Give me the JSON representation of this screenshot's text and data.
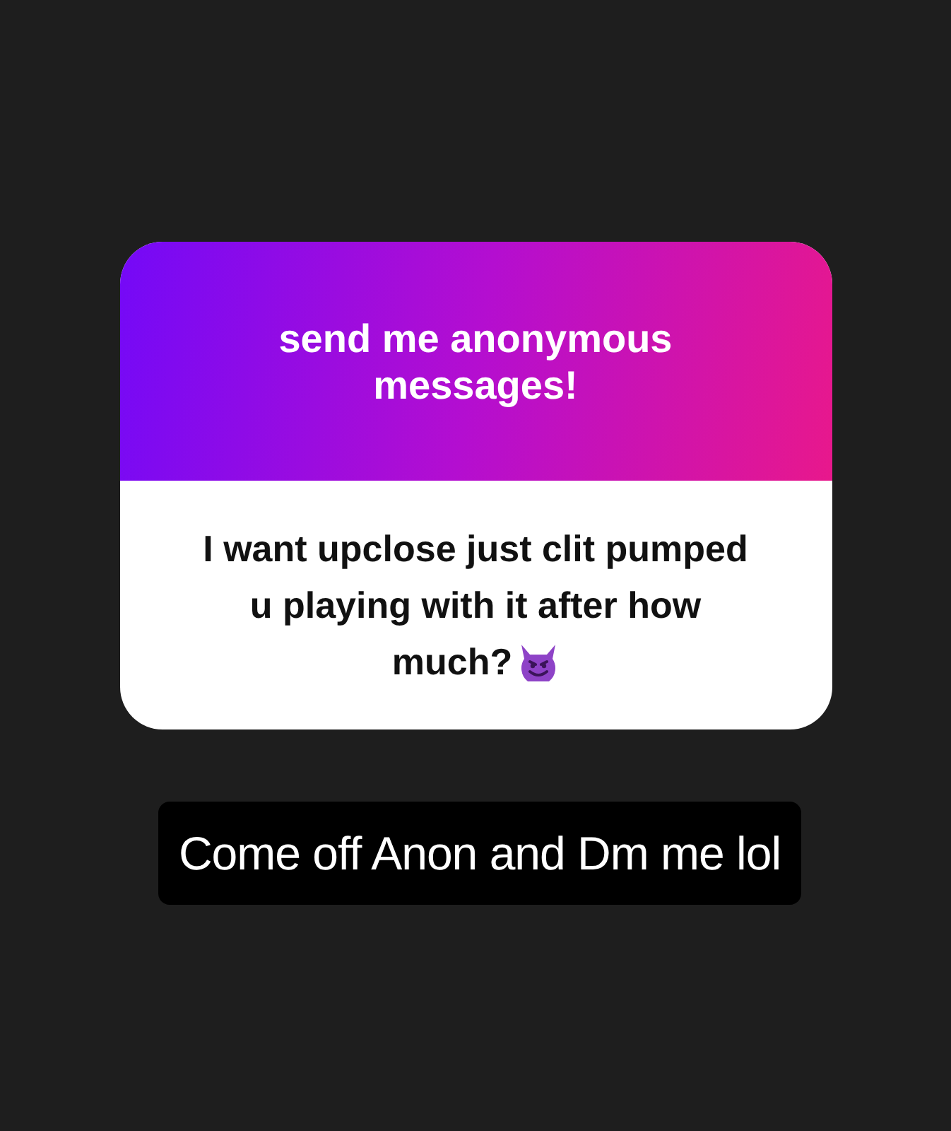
{
  "question_card": {
    "title": "send me anonymous messages!",
    "message_lines": [
      "I want upclose just clit pumped",
      "u playing with it after how",
      "much?"
    ]
  },
  "reply_caption": "Come off Anon and Dm me lol"
}
